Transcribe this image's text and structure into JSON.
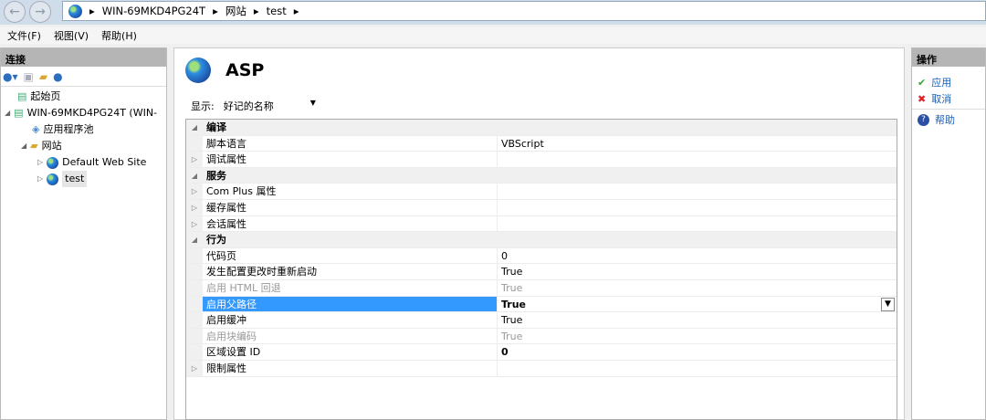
{
  "address": {
    "crumbs": [
      "WIN-69MKD4PG24T",
      "网站",
      "test"
    ]
  },
  "menu": [
    "文件(F)",
    "视图(V)",
    "帮助(H)"
  ],
  "connections": {
    "title": "连接",
    "tree": [
      {
        "label": "起始页",
        "level": 0
      },
      {
        "label": "WIN-69MKD4PG24T (WIN-",
        "level": 0
      },
      {
        "label": "应用程序池",
        "level": 1
      },
      {
        "label": "网站",
        "level": 1
      },
      {
        "label": "Default Web Site",
        "level": 2
      },
      {
        "label": "test",
        "level": 2
      }
    ]
  },
  "main": {
    "title": "ASP",
    "show_label": "显示:",
    "show_value": "好记的名称",
    "rows": [
      {
        "type": "cat",
        "name": "编译",
        "value": ""
      },
      {
        "type": "prop",
        "name": "脚本语言",
        "value": "VBScript"
      },
      {
        "type": "group",
        "name": "调试属性",
        "value": ""
      },
      {
        "type": "cat",
        "name": "服务",
        "value": ""
      },
      {
        "type": "group",
        "name": "Com Plus 属性",
        "value": ""
      },
      {
        "type": "group",
        "name": "缓存属性",
        "value": ""
      },
      {
        "type": "group",
        "name": "会话属性",
        "value": ""
      },
      {
        "type": "cat",
        "name": "行为",
        "value": ""
      },
      {
        "type": "prop",
        "name": "代码页",
        "value": "0"
      },
      {
        "type": "prop",
        "name": "发生配置更改时重新启动",
        "value": "True"
      },
      {
        "type": "dis",
        "name": "启用 HTML 回退",
        "value": "True"
      },
      {
        "type": "sel",
        "name": "启用父路径",
        "value": "True"
      },
      {
        "type": "prop",
        "name": "启用缓冲",
        "value": "True"
      },
      {
        "type": "dis",
        "name": "启用块编码",
        "value": "True"
      },
      {
        "type": "bold",
        "name": "区域设置 ID",
        "value": "0"
      },
      {
        "type": "group",
        "name": "限制属性",
        "value": ""
      }
    ]
  },
  "actions": {
    "title": "操作",
    "items": [
      "应用",
      "取消",
      "帮助"
    ]
  }
}
